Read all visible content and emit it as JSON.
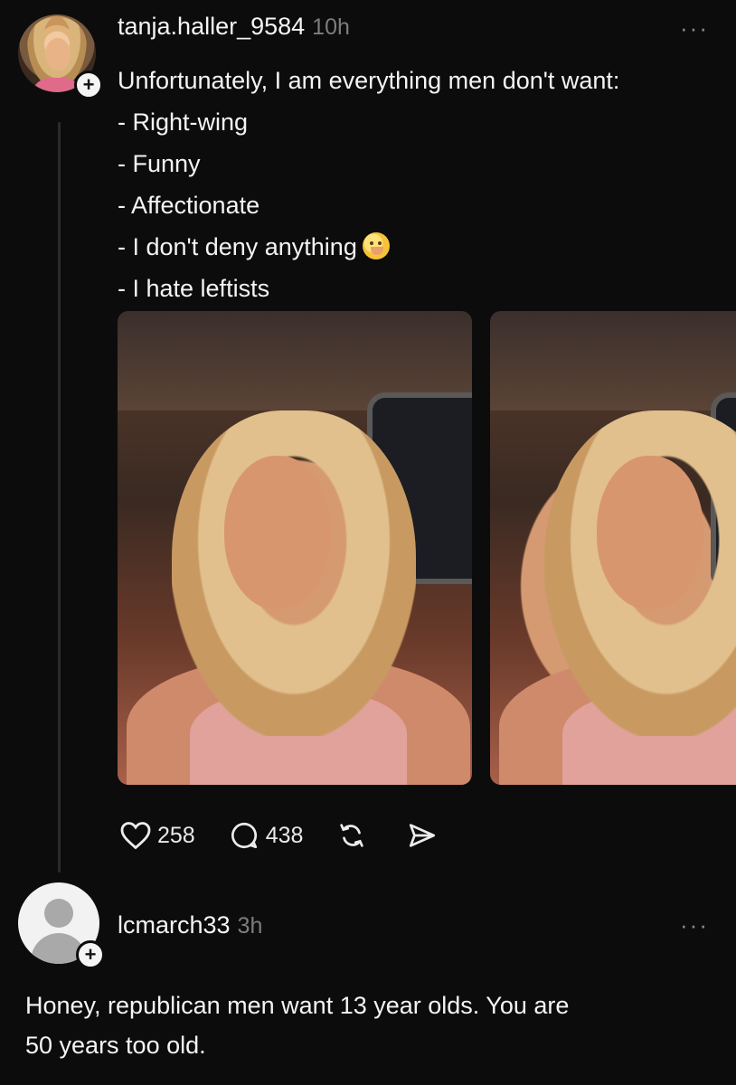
{
  "post": {
    "username": "tanja.haller_9584",
    "time": "10h",
    "more": "···",
    "lines": [
      "Unfortunately, I am everything men don't want:",
      "- Right-wing",
      "- Funny",
      "- Affectionate",
      "- I don't deny anything",
      "- I hate leftists"
    ],
    "emoji": "shushing-face-emoji",
    "likes": "258",
    "comments": "438"
  },
  "reply": {
    "username": "lcmarch33",
    "time": "3h",
    "more": "···",
    "lines": [
      "Honey, republican men want 13 year olds. You are",
      "50 years too old."
    ]
  },
  "icons": {
    "like": "heart-icon",
    "comment": "comment-bubble-icon",
    "repost": "repost-icon",
    "share": "send-icon",
    "follow": "plus-icon"
  },
  "colors": {
    "background": "#0c0c0c",
    "text": "#f4f4f4",
    "muted": "#7d7d7d"
  }
}
